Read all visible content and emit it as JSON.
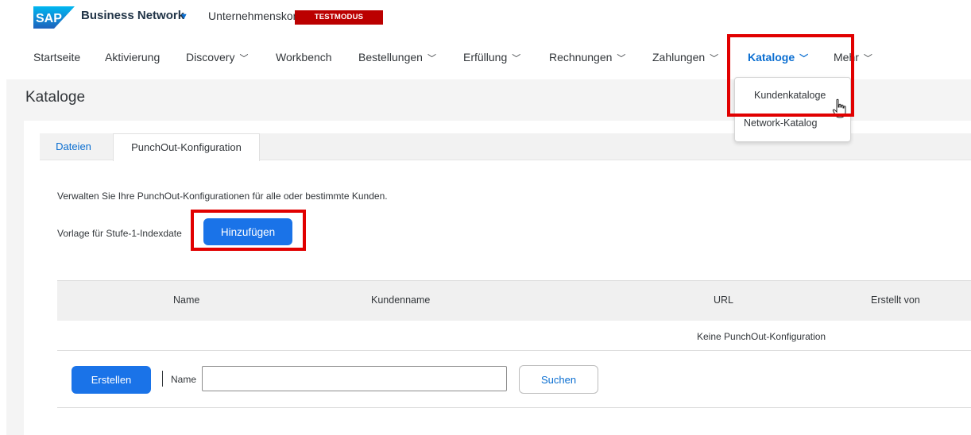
{
  "header": {
    "logo_text": "SAP",
    "app_title": "Business Network",
    "account_label": "Unternehmenskonto",
    "mode_badge": "TESTMODUS"
  },
  "nav": {
    "items": [
      {
        "label": "Startseite",
        "has_dropdown": false
      },
      {
        "label": "Aktivierung",
        "has_dropdown": false
      },
      {
        "label": "Discovery",
        "has_dropdown": true
      },
      {
        "label": "Workbench",
        "has_dropdown": false
      },
      {
        "label": "Bestellungen",
        "has_dropdown": true
      },
      {
        "label": "Erfüllung",
        "has_dropdown": true
      },
      {
        "label": "Rechnungen",
        "has_dropdown": true
      },
      {
        "label": "Zahlungen",
        "has_dropdown": true
      },
      {
        "label": "Kataloge",
        "has_dropdown": true,
        "active": true
      },
      {
        "label": "Mehr",
        "has_dropdown": true
      }
    ],
    "dropdown_items": [
      "Kundenkataloge",
      "Network-Katalog"
    ]
  },
  "page": {
    "title": "Kataloge",
    "tabs": [
      {
        "label": "Dateien",
        "selected": false
      },
      {
        "label": "PunchOut-Konfiguration",
        "selected": true
      }
    ],
    "description": "Verwalten Sie Ihre PunchOut-Konfigurationen für alle oder bestimmte Kunden.",
    "template_label": "Vorlage für Stufe-1-Indexdate",
    "add_button": "Hinzufügen"
  },
  "table": {
    "columns": [
      "Name",
      "Kundenname",
      "URL",
      "Erstellt von"
    ],
    "empty_message": "Keine PunchOut-Konfiguration"
  },
  "footer_controls": {
    "create_button": "Erstellen",
    "name_label": "Name",
    "name_value": "",
    "search_button": "Suchen"
  },
  "colors": {
    "accent": "#0a6ed1",
    "button_blue": "#1a73e8",
    "badge_red": "#bb0000",
    "highlight_red": "#e10000"
  }
}
